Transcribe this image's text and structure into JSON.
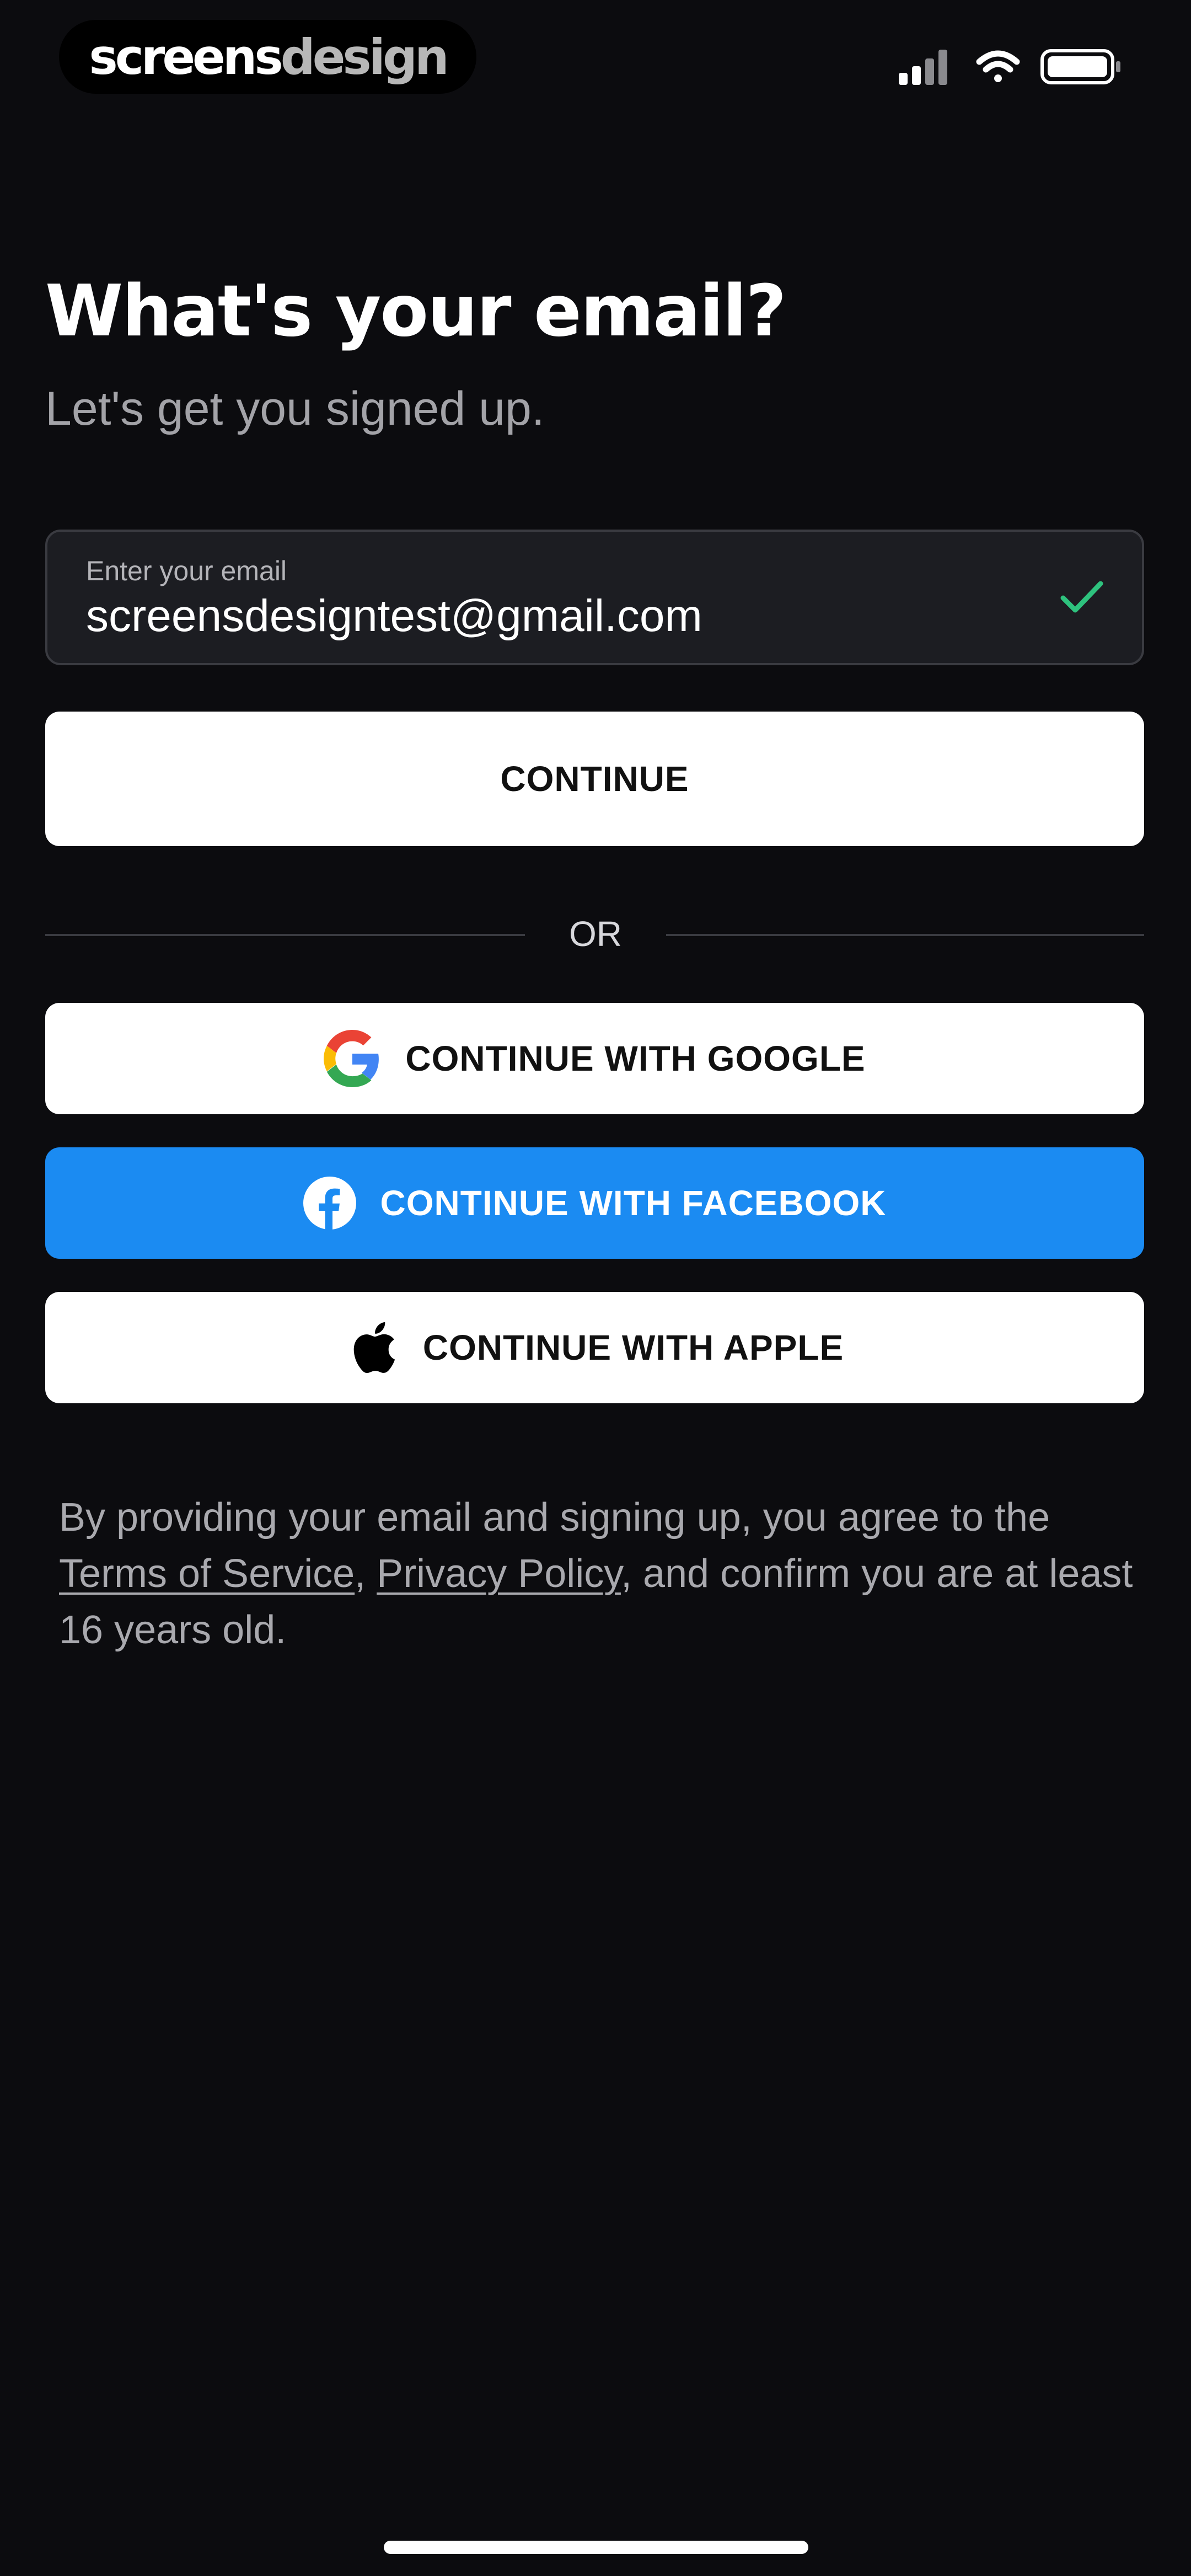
{
  "status_bar": {
    "brand_part1": "screens",
    "brand_part2": "design",
    "icons": [
      "signal-icon",
      "wifi-icon",
      "battery-icon"
    ]
  },
  "heading": {
    "title": "What's your email?",
    "subtitle": "Let's get you signed up."
  },
  "email_field": {
    "label": "Enter your email",
    "value": "screensdesigntest@gmail.com",
    "valid": true,
    "valid_color": "#2ec27e"
  },
  "buttons": {
    "continue": "CONTINUE",
    "google": "CONTINUE WITH GOOGLE",
    "facebook": "CONTINUE WITH FACEBOOK",
    "apple": "CONTINUE WITH APPLE"
  },
  "divider": {
    "text": "OR"
  },
  "legal": {
    "prefix": "By providing your email and signing up, you agree to the",
    "terms_link": "Terms of Service",
    "separator": ",",
    "privacy_link": "Privacy Policy",
    "suffix": ", and confirm you are at least 16 years old."
  },
  "colors": {
    "background": "#0c0c0f",
    "facebook_blue": "#1b8bf2",
    "field_background": "#1c1d22"
  }
}
